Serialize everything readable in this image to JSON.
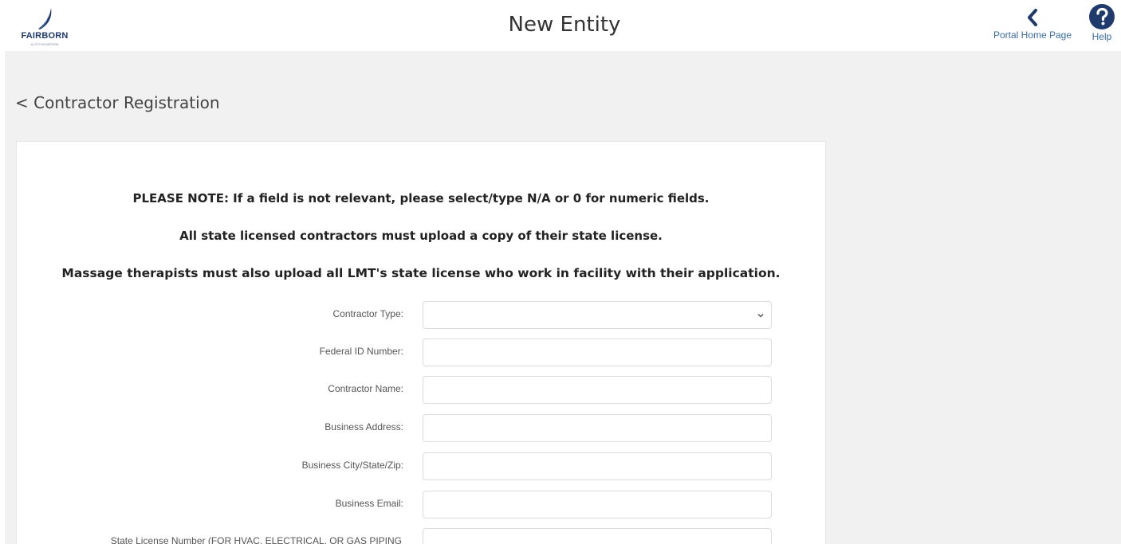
{
  "header": {
    "logo_text": "FAIRBORN",
    "logo_subtext": "A CITY IN MOTION",
    "title": "New Entity",
    "home_label": "Portal Home Page",
    "help_label": "Help",
    "home_icon": "chevron-left-icon",
    "help_icon": "help-circle-icon"
  },
  "breadcrumb": "< Contractor Registration",
  "notes": [
    "PLEASE NOTE: If a field is not relevant, please select/type N/A or 0 for numeric fields.",
    "All state licensed contractors must upload a copy of their state license.",
    "Massage therapists must also upload all LMT's state license who work in facility with their application."
  ],
  "fields": [
    {
      "label": "Contractor Type:",
      "type": "select",
      "value": ""
    },
    {
      "label": "Federal ID Number:",
      "type": "text",
      "value": ""
    },
    {
      "label": "Contractor Name:",
      "type": "text",
      "value": ""
    },
    {
      "label": "Business Address:",
      "type": "text",
      "value": ""
    },
    {
      "label": "Business City/State/Zip:",
      "type": "text",
      "value": ""
    },
    {
      "label": "Business Email:",
      "type": "text",
      "value": ""
    },
    {
      "label": "State License Number (FOR HVAC, ELECTRICAL, OR GAS PIPING",
      "type": "text",
      "value": ""
    }
  ],
  "colors": {
    "accent": "#3a6ea5",
    "icon": "#1f3b6e",
    "background": "#f1f1f1"
  }
}
